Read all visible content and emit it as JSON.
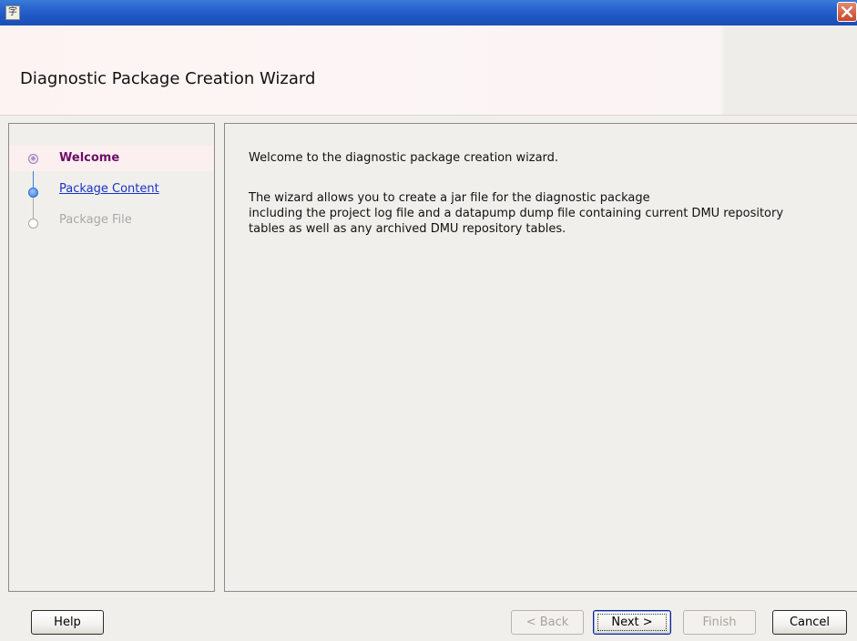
{
  "window": {
    "title": "",
    "app_icon_glyph": "字"
  },
  "header": {
    "title": "Diagnostic Package Creation Wizard"
  },
  "steps": [
    {
      "label": "Welcome",
      "state": "current"
    },
    {
      "label": "Package Content",
      "state": "link"
    },
    {
      "label": "Package File",
      "state": "disabled"
    }
  ],
  "content": {
    "intro": "Welcome to the diagnostic package creation wizard.",
    "body_line1": "The wizard allows you to create a jar file for the diagnostic package",
    "body_line2": "including the project log file and a datapump dump file containing current DMU repository",
    "body_line3": "tables as well as any archived DMU repository tables."
  },
  "buttons": {
    "help": "Help",
    "back": "< Back",
    "next": "Next >",
    "finish": "Finish",
    "cancel": "Cancel"
  },
  "colors": {
    "titlebar": "#2b66cf",
    "current_step": "#6a0f6a",
    "link": "#1a32c8",
    "disabled": "#a8a8a8"
  }
}
